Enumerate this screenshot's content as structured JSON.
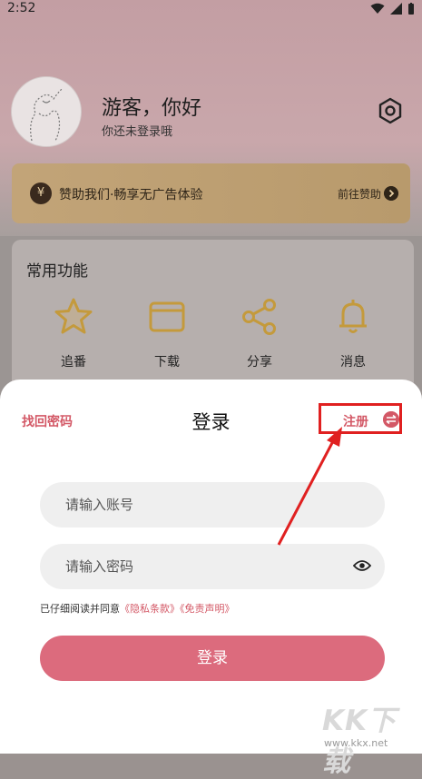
{
  "status_bar": {
    "time": "2:52"
  },
  "profile": {
    "greeting": "游客，你好",
    "subtitle": "你还未登录哦",
    "avatar_icon": "avatar-sketch-icon"
  },
  "sponsor": {
    "icon": "yuan-icon",
    "text": "赞助我们·畅享无广告体验",
    "link": "前往赞助"
  },
  "features": {
    "title": "常用功能",
    "items": [
      {
        "label": "追番",
        "icon": "star-icon"
      },
      {
        "label": "下载",
        "icon": "folder-icon"
      },
      {
        "label": "分享",
        "icon": "share-icon"
      },
      {
        "label": "消息",
        "icon": "bell-icon"
      }
    ]
  },
  "login_sheet": {
    "forgot": "找回密码",
    "title": "登录",
    "register": "注册",
    "account_placeholder": "请输入账号",
    "password_placeholder": "请输入密码",
    "agree_text": "已仔细阅读并同意",
    "privacy_link": "《隐私条款》",
    "disclaimer_link": "《免责声明》",
    "login_button": "登录"
  },
  "watermark": {
    "text": "KK下载",
    "url": "www.kkx.net"
  },
  "colors": {
    "accent": "#d35866",
    "button": "#dc6b7d",
    "highlight": "#e02020",
    "gold_icon": "#c49a3c"
  }
}
